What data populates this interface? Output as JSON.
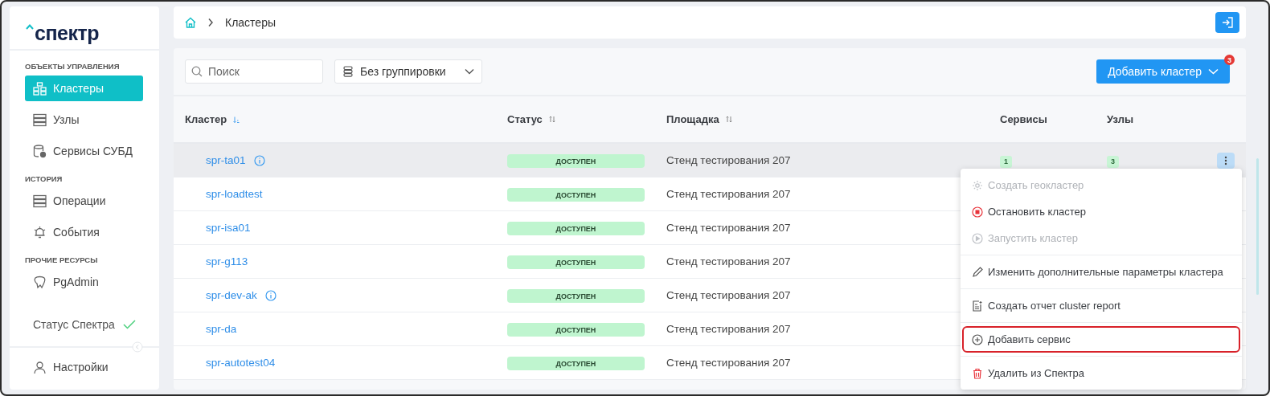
{
  "logo": {
    "text": "спектр"
  },
  "sidebar": {
    "sections": [
      {
        "title": "ОБЪЕКТЫ УПРАВЛЕНИЯ",
        "items": [
          {
            "label": "Кластеры",
            "selected": true
          },
          {
            "label": "Узлы",
            "selected": false
          },
          {
            "label": "Сервисы СУБД",
            "selected": false
          }
        ]
      },
      {
        "title": "ИСТОРИЯ",
        "items": [
          {
            "label": "Операции",
            "selected": false
          },
          {
            "label": "События",
            "selected": false
          }
        ]
      },
      {
        "title": "ПРОЧИЕ РЕСУРСЫ",
        "items": [
          {
            "label": "PgAdmin",
            "selected": false
          }
        ]
      }
    ],
    "status": {
      "label": "Статус Спектра",
      "ok": true
    },
    "settings": {
      "label": "Настройки"
    }
  },
  "breadcrumb": [
    "Кластеры"
  ],
  "toolbar": {
    "search": {
      "placeholder": "Поиск"
    },
    "grouping": {
      "value": "Без группировки"
    },
    "add_button": {
      "label": "Добавить кластер",
      "badge": "3"
    }
  },
  "table": {
    "columns": [
      "Кластер",
      "Статус",
      "Площадка",
      "Сервисы",
      "Узлы"
    ],
    "rows": [
      {
        "name": "spr-ta01",
        "info": true,
        "status": "ДОСТУПЕН",
        "site": "Стенд тестирования 207",
        "services": "1",
        "nodes": "3",
        "hovered": true
      },
      {
        "name": "spr-loadtest",
        "info": false,
        "status": "ДОСТУПЕН",
        "site": "Стенд тестирования 207",
        "hovered": false
      },
      {
        "name": "spr-isa01",
        "info": false,
        "status": "ДОСТУПЕН",
        "site": "Стенд тестирования 207",
        "hovered": false
      },
      {
        "name": "spr-g113",
        "info": false,
        "status": "ДОСТУПЕН",
        "site": "Стенд тестирования 207",
        "hovered": false
      },
      {
        "name": "spr-dev-ak",
        "info": true,
        "status": "ДОСТУПЕН",
        "site": "Стенд тестирования 207",
        "hovered": false
      },
      {
        "name": "spr-da",
        "info": false,
        "status": "ДОСТУПЕН",
        "site": "Стенд тестирования 207",
        "hovered": false
      },
      {
        "name": "spr-autotest04",
        "info": false,
        "status": "ДОСТУПЕН",
        "site": "Стенд тестирования 207",
        "hovered": false
      }
    ]
  },
  "context_menu": {
    "groups": [
      [
        {
          "label": "Создать геокластер",
          "disabled": true,
          "highlighted": false
        },
        {
          "label": "Остановить кластер",
          "disabled": false,
          "highlighted": false
        },
        {
          "label": "Запустить кластер",
          "disabled": true,
          "highlighted": false
        }
      ],
      [
        {
          "label": "Изменить дополнительные параметры кластера",
          "disabled": false,
          "highlighted": false
        }
      ],
      [
        {
          "label": "Создать отчет cluster report",
          "disabled": false,
          "highlighted": false
        }
      ],
      [
        {
          "label": "Добавить сервис",
          "disabled": false,
          "highlighted": true
        }
      ],
      [
        {
          "label": "Удалить из Спектра",
          "disabled": false,
          "highlighted": false
        }
      ]
    ]
  }
}
